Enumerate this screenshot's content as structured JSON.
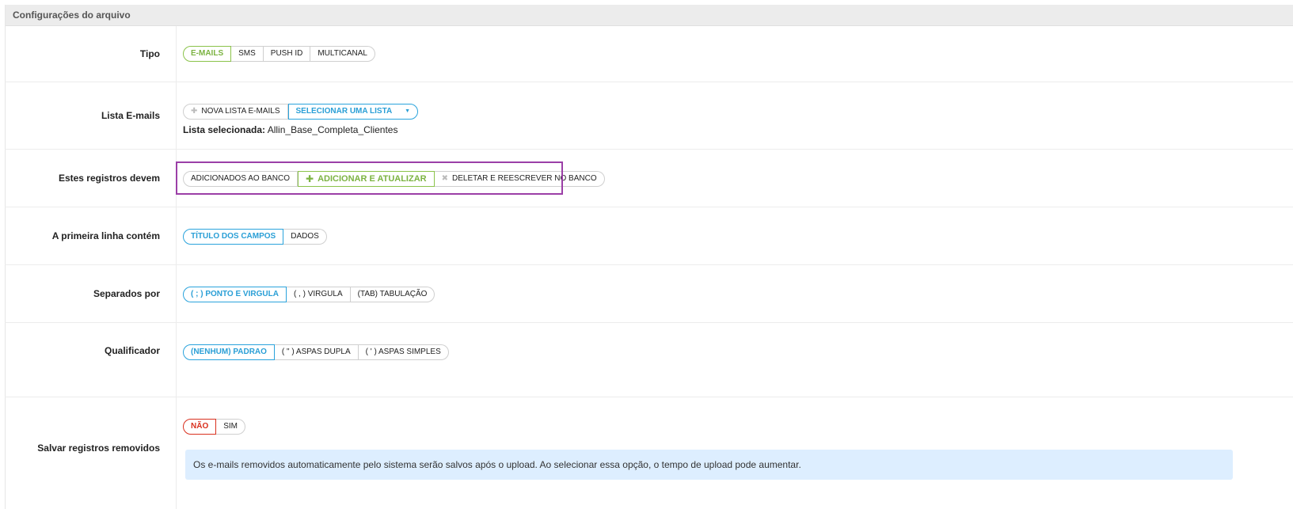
{
  "panel": {
    "title": "Configurações do arquivo"
  },
  "rows": {
    "tipo": {
      "label": "Tipo",
      "options": [
        "E-MAILS",
        "SMS",
        "PUSH ID",
        "MULTICANAL"
      ]
    },
    "lista": {
      "label": "Lista E-mails",
      "new_list": "NOVA LISTA E-MAILS",
      "select_list": "SELECIONAR UMA LISTA",
      "selected_label": "Lista selecionada:",
      "selected_value": "Allin_Base_Completa_Clientes"
    },
    "registros": {
      "label": "Estes registros devem",
      "options": [
        "ADICIONADOS AO BANCO",
        "ADICIONAR E ATUALIZAR",
        "DELETAR E REESCREVER NO BANCO"
      ]
    },
    "primeira": {
      "label": "A primeira linha contém",
      "options": [
        "TÍTULO DOS CAMPOS",
        "DADOS"
      ]
    },
    "separados": {
      "label": "Separados por",
      "options": [
        "( ; ) PONTO E VIRGULA",
        "( , ) VIRGULA",
        "(TAB) TABULAÇÃO"
      ]
    },
    "qualificador": {
      "label": "Qualificador",
      "options": [
        "(NENHUM) PADRAO",
        "( \" ) ASPAS DUPLA",
        "( ' ) ASPAS SIMPLES"
      ]
    },
    "salvar": {
      "label": "Salvar registros removidos",
      "options": [
        "NÃO",
        "SIM"
      ],
      "info": "Os e-mails removidos automaticamente pelo sistema serão salvos após o upload. Ao selecionar essa opção, o tempo de upload pode aumentar."
    }
  },
  "colors": {
    "green": "#7cb342",
    "blue": "#2a9fd6",
    "red": "#d9301e",
    "highlight": "#9b3fa7"
  }
}
